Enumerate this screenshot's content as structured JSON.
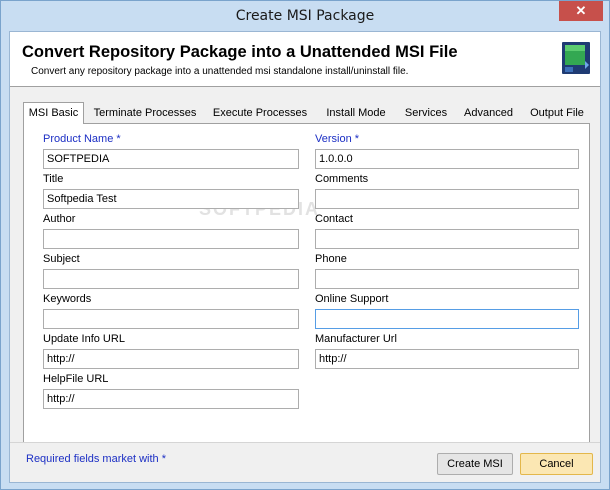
{
  "window": {
    "title": "Create MSI Package",
    "close_label": "✕"
  },
  "header": {
    "title": "Convert Repository Package into a Unattended MSI File",
    "subtitle": "Convert any repository package into a unattended msi standalone install/uninstall file."
  },
  "tabs": [
    {
      "label": "MSI Basic",
      "active": true
    },
    {
      "label": "Terminate Processes",
      "active": false
    },
    {
      "label": "Execute Processes",
      "active": false
    },
    {
      "label": "Install Mode",
      "active": false
    },
    {
      "label": "Services",
      "active": false
    },
    {
      "label": "Advanced",
      "active": false
    },
    {
      "label": "Output File",
      "active": false
    }
  ],
  "watermark": "SOFTPEDIA",
  "form": {
    "product_name": {
      "label": "Product Name *",
      "value": "SOFTPEDIA"
    },
    "version": {
      "label": "Version *",
      "value": "1.0.0.0"
    },
    "title": {
      "label": "Title",
      "value": "Softpedia Test"
    },
    "comments": {
      "label": "Comments",
      "value": ""
    },
    "author": {
      "label": "Author",
      "value": ""
    },
    "contact": {
      "label": "Contact",
      "value": ""
    },
    "subject": {
      "label": "Subject",
      "value": ""
    },
    "phone": {
      "label": "Phone",
      "value": ""
    },
    "keywords": {
      "label": "Keywords",
      "value": ""
    },
    "online_support": {
      "label": "Online Support",
      "value": ""
    },
    "update_info_url": {
      "label": "Update Info URL",
      "value": "http://"
    },
    "manufacturer_url": {
      "label": "Manufacturer Url",
      "value": "http://"
    },
    "helpfile_url": {
      "label": "HelpFile URL",
      "value": "http://"
    }
  },
  "footer": {
    "note": "Required fields market with *",
    "create_label": "Create MSI",
    "cancel_label": "Cancel"
  },
  "colors": {
    "required_label": "#1c2fc4",
    "titlebar": "#c8ddf2",
    "close_button": "#c7504b",
    "cancel_button": "#fbe7b3"
  },
  "icons": {
    "header": "msi-package-icon",
    "close": "close-icon"
  }
}
